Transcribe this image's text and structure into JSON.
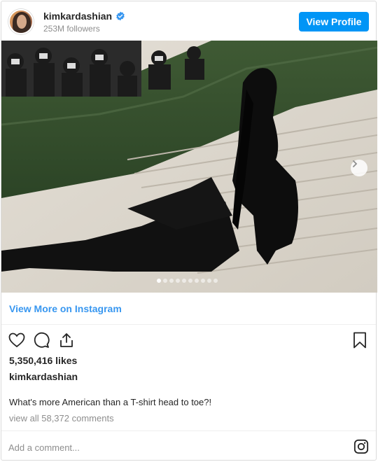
{
  "header": {
    "username": "kimkardashian",
    "followers": "253M followers",
    "view_profile_label": "View Profile"
  },
  "post": {
    "carousel": {
      "total_slides": 10,
      "active_slide": 1
    },
    "view_more_label": "View More on Instagram",
    "likes": "5,350,416 likes",
    "owner": "kimkardashian",
    "caption": "What's more American than a T-shirt head to toe?!",
    "comments_link": "view all 58,372 comments",
    "add_comment_placeholder": "Add a comment..."
  },
  "colors": {
    "accent": "#0095f6",
    "link": "#3897f0",
    "verified": "#3897f0"
  },
  "icons": {
    "verified": "verified-badge-icon",
    "like": "heart-icon",
    "comment": "comment-bubble-icon",
    "share": "share-icon",
    "save": "bookmark-icon",
    "next": "chevron-right-icon",
    "instagram": "instagram-logo-icon"
  }
}
